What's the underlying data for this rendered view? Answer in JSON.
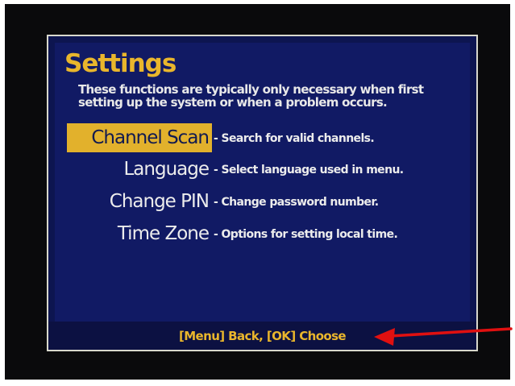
{
  "settings": {
    "title": "Settings",
    "subtitle": "These functions are typically only necessary when first setting up the system or when a problem occurs."
  },
  "menu": {
    "items": [
      {
        "label": "Channel Scan",
        "description": "- Search for valid channels.",
        "selected": true
      },
      {
        "label": "Language",
        "description": "- Select language used in menu.",
        "selected": false
      },
      {
        "label": "Change PIN",
        "description": "- Change password number.",
        "selected": false
      },
      {
        "label": "Time Zone",
        "description": "- Options for setting local time.",
        "selected": false
      }
    ]
  },
  "footer": {
    "hint": "[Menu] Back, [OK] Choose"
  },
  "colors": {
    "panel_bg": "#111a64",
    "accent": "#e2b12c",
    "text": "#ececec",
    "annotation_arrow": "#e01010"
  },
  "icons": {
    "annotation": "red-arrow-left"
  }
}
